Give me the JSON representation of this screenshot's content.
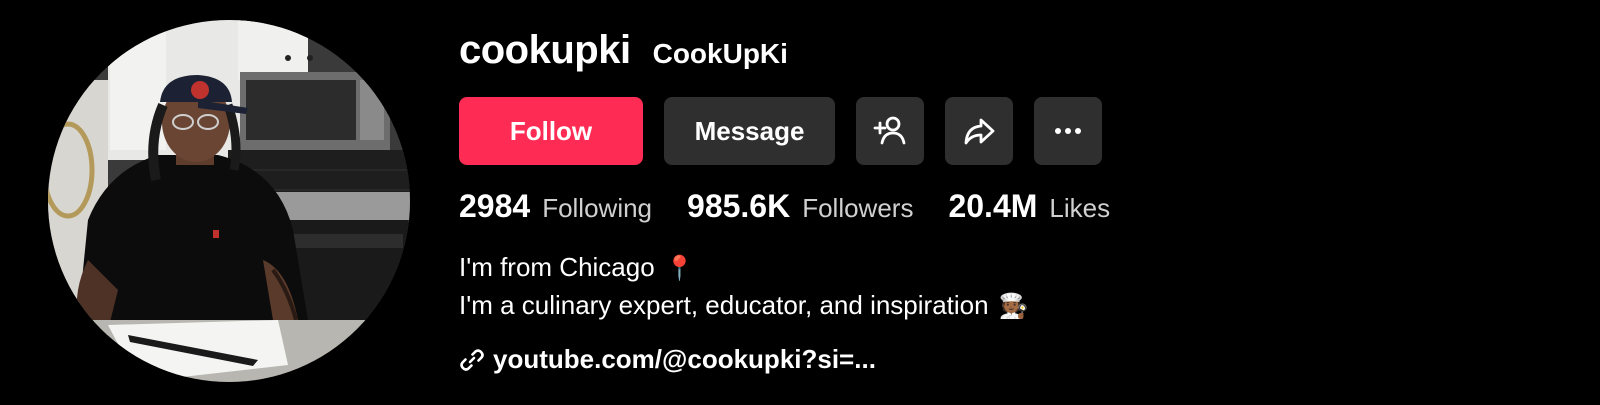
{
  "profile": {
    "username": "cookupki",
    "nickname": "CookUpKi",
    "avatar_icon": "profile-photo"
  },
  "actions": {
    "follow_label": "Follow",
    "message_label": "Message",
    "add_friend_icon": "add-person-icon",
    "share_icon": "share-icon",
    "more_icon": "more-icon"
  },
  "stats": {
    "following": {
      "value": "2984",
      "label": "Following"
    },
    "followers": {
      "value": "985.6K",
      "label": "Followers"
    },
    "likes": {
      "value": "20.4M",
      "label": "Likes"
    }
  },
  "bio": {
    "line1": "I'm from Chicago",
    "line1_emoji": "📍",
    "line2": "I'm a culinary expert, educator, and inspiration",
    "line2_emoji": "🧑🏾‍🍳"
  },
  "link": {
    "text": "youtube.com/@cookupki?si=..."
  },
  "colors": {
    "background": "#000000",
    "follow_button": "#fe2c55",
    "secondary_button": "#2f2f2f",
    "muted_text": "#d0d0d0"
  }
}
